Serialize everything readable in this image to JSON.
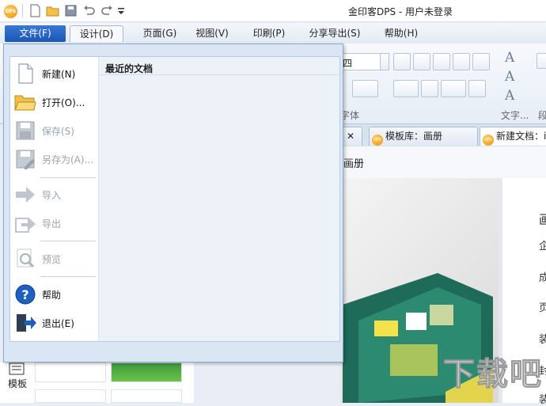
{
  "app_title": "金印客DPS - 用户未登录",
  "logo_text": "DPS",
  "menu": {
    "tabs": [
      {
        "label": "文件(F)"
      },
      {
        "label": "设计(D)"
      },
      {
        "label": "页面(G)"
      },
      {
        "label": "视图(V)"
      },
      {
        "label": "印刷(P)"
      },
      {
        "label": "分享导出(S)"
      },
      {
        "label": "帮助(H)"
      }
    ]
  },
  "ribbon": {
    "font_value": "四",
    "group_font": "字体",
    "group_text": "文字...",
    "group_para": "段"
  },
  "file_menu": {
    "items": [
      {
        "label": "新建(N)",
        "icon": "new-document-icon",
        "enabled": true
      },
      {
        "label": "打开(O)...",
        "icon": "open-folder-icon",
        "enabled": true
      },
      {
        "label": "保存(S)",
        "icon": "save-icon",
        "enabled": false
      },
      {
        "label": "另存为(A)...",
        "icon": "save-as-icon",
        "enabled": false
      },
      {
        "label": "导入",
        "icon": "import-icon",
        "enabled": false
      },
      {
        "label": "导出",
        "icon": "export-icon",
        "enabled": false
      },
      {
        "label": "预览",
        "icon": "preview-icon",
        "enabled": false
      },
      {
        "label": "帮助",
        "icon": "help-icon",
        "enabled": true
      },
      {
        "label": "退出(E)",
        "icon": "exit-icon",
        "enabled": true
      }
    ],
    "recent_title": "最近的文档"
  },
  "doc_tabs": [
    {
      "label": "模板库：画册"
    },
    {
      "label": "新建文档：i"
    }
  ],
  "breadcrumb": "画册",
  "right_page_chars": [
    "画",
    "企",
    "成",
    "页",
    "装",
    "封",
    "装"
  ],
  "left_panel": {
    "template_label": "模板"
  },
  "watermark": "下载吧",
  "colors": {
    "accent": "#1c55b6",
    "logo": "#f08a00"
  }
}
